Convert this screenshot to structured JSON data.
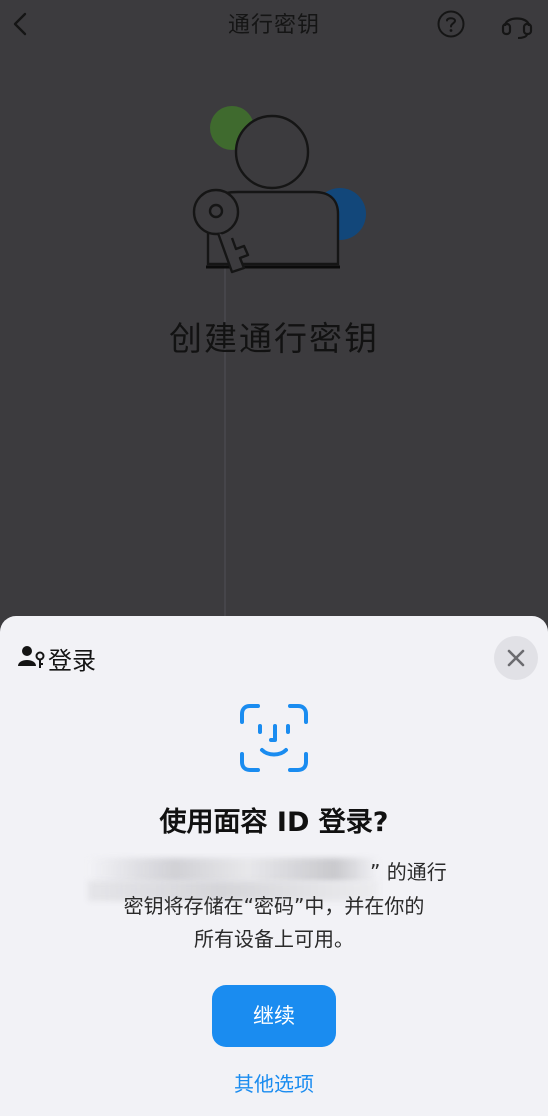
{
  "nav": {
    "title": "通行密钥",
    "back_icon": "chevron-left-icon",
    "help_icon": "question-circle-icon",
    "support_icon": "headset-icon"
  },
  "hero": {
    "title": "创建通行密钥"
  },
  "sheet": {
    "header_icon": "person-key-icon",
    "header_label": "登录",
    "close_icon": "close-icon",
    "faceid_icon": "face-id-icon",
    "prompt_title": "使用面容 ID 登录?",
    "body_line_1": "” 的通行",
    "body_line_2": "密钥将存储在“密码”中，并在你的",
    "body_line_3": "所有设备上可用。",
    "continue_label": "继续",
    "other_options_label": "其他选项"
  },
  "colors": {
    "accent": "#1a8cf0",
    "dimmed_background": "#3c3b3e",
    "sheet_background": "#f2f2f6",
    "hero_green": "#3f6a2e",
    "hero_blue": "#12477a"
  }
}
